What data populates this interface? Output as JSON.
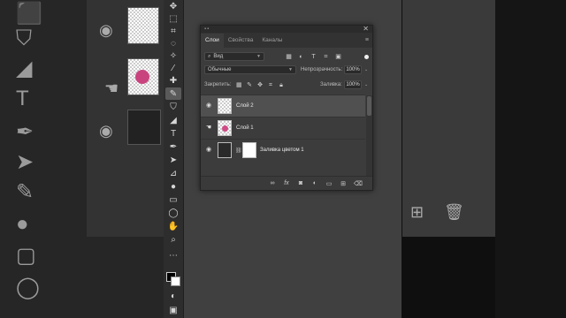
{
  "app": {
    "accent_color": "#505050",
    "panel_bg": "#3c3c3c"
  },
  "layers_panel": {
    "tabs": [
      {
        "label": "Слои",
        "active": true
      },
      {
        "label": "Свойства",
        "active": false
      },
      {
        "label": "Каналы",
        "active": false
      }
    ],
    "filter": {
      "label": "Вид",
      "icons": [
        "pixel-filter-icon",
        "adjustment-filter-icon",
        "type-filter-icon",
        "shape-filter-icon",
        "smart-object-filter-icon"
      ]
    },
    "blend_mode": "Обычные",
    "opacity_label": "Непрозрачность:",
    "opacity_value": "100%",
    "lock_label": "Закрепить:",
    "fill_label": "Заливка:",
    "fill_value": "100%",
    "layers": [
      {
        "name": "Слой 2",
        "visible": true,
        "selected": true,
        "thumb": "transparent"
      },
      {
        "name": "Слой 1",
        "visible": false,
        "selected": false,
        "thumb": "flower"
      },
      {
        "name": "Заливка цветом 1",
        "visible": true,
        "selected": false,
        "thumb": "fill"
      }
    ],
    "footer_icons": [
      "link-icon",
      "fx-icon",
      "mask-icon",
      "adjustment-icon",
      "group-icon",
      "new-layer-icon",
      "trash-icon"
    ]
  },
  "toolbar": {
    "tools": [
      "move-tool-icon",
      "marquee-tool-icon",
      "crop-tool-icon",
      "lasso-tool-icon",
      "magic-wand-icon",
      "eyedropper-icon",
      "healing-brush-icon",
      "brush-tool-icon",
      "stamp-tool-icon",
      "eraser-tool-icon",
      "type-tool-icon",
      "pen-tool-icon",
      "path-select-icon",
      "ruler-icon",
      "brush-alt-icon",
      "dodge-tool-icon",
      "gradient-tool-icon",
      "ellipse-tool-icon",
      "hand-tool-icon",
      "zoom-tool-icon"
    ],
    "foreground_color": "#000000",
    "background_color": "#ffffff"
  }
}
